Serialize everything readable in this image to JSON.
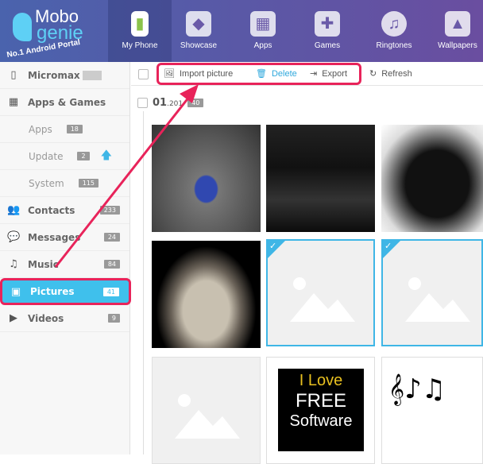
{
  "header": {
    "logo_top": "Mobo",
    "logo_bottom": "genie",
    "slogan": "No.1 Android Portal",
    "nav": [
      {
        "label": "My Phone",
        "icon": "android-phone-icon"
      },
      {
        "label": "Showcase",
        "icon": "cube-icon"
      },
      {
        "label": "Apps",
        "icon": "apps-grid-icon"
      },
      {
        "label": "Games",
        "icon": "gamepad-icon"
      },
      {
        "label": "Ringtones",
        "icon": "music-note-icon"
      },
      {
        "label": "Wallpapers",
        "icon": "wallpaper-icon"
      }
    ]
  },
  "sidebar": {
    "device": "Micromax",
    "items": [
      {
        "label": "Apps & Games"
      },
      {
        "label": "Apps",
        "count": "18"
      },
      {
        "label": "Update",
        "count": "2"
      },
      {
        "label": "System",
        "count": "115"
      },
      {
        "label": "Contacts",
        "count": "233"
      },
      {
        "label": "Messages",
        "count": "24"
      },
      {
        "label": "Music",
        "count": "84"
      },
      {
        "label": "Pictures",
        "count": "41"
      },
      {
        "label": "Videos",
        "count": "9"
      }
    ]
  },
  "toolbar": {
    "import": "Import picture",
    "delete": "Delete",
    "export": "Export",
    "refresh": "Refresh"
  },
  "group": {
    "date_day": "01",
    "date_rest": ".201",
    "count": "40"
  },
  "photos": {
    "love_line1": "I Love",
    "love_line2": "FREE",
    "love_line3": "Software"
  },
  "colors": {
    "accent": "#3fc0ec",
    "highlight": "#e8235a"
  }
}
